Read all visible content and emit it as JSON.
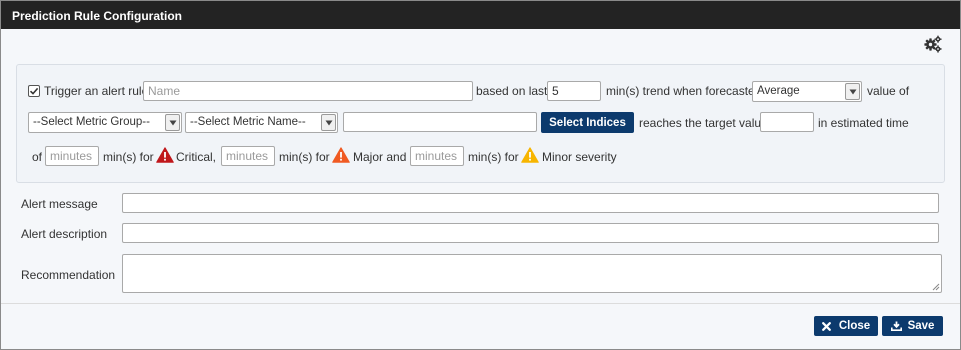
{
  "window": {
    "title": "Prediction Rule Configuration"
  },
  "rule": {
    "enabled": true,
    "trigger_label": "Trigger an alert rule",
    "name_placeholder": "Name",
    "based_on_label": "based on last",
    "minutes_value": "5",
    "trend_label": "min(s) trend when forecasted",
    "aggregation_value": "Average",
    "value_of_label": "value of",
    "metric_group_value": "--Select Metric Group--",
    "metric_name_value": "--Select Metric Name--",
    "select_indices_label": "Select Indices",
    "reaches_label": "reaches the target value",
    "estimated_label": "in estimated time",
    "of_label": "of",
    "minutes_placeholder": "minutes",
    "critical_suffix": "min(s) for",
    "critical_label": "Critical,",
    "major_label": "Major and",
    "minor_label": "Minor severity"
  },
  "form": {
    "alert_message_label": "Alert message",
    "alert_description_label": "Alert description",
    "recommendation_label": "Recommendation"
  },
  "footer": {
    "close_label": "Close",
    "save_label": "Save"
  },
  "icons": {
    "settings": "gears-icon",
    "critical": "warning-triangle-red-icon",
    "major": "warning-triangle-orange-icon",
    "minor": "warning-triangle-yellow-icon"
  },
  "colors": {
    "titlebar": "#232323",
    "button": "#0c3a6d",
    "critical": "#c0171b",
    "major": "#f05a22",
    "minor": "#f7b500"
  }
}
